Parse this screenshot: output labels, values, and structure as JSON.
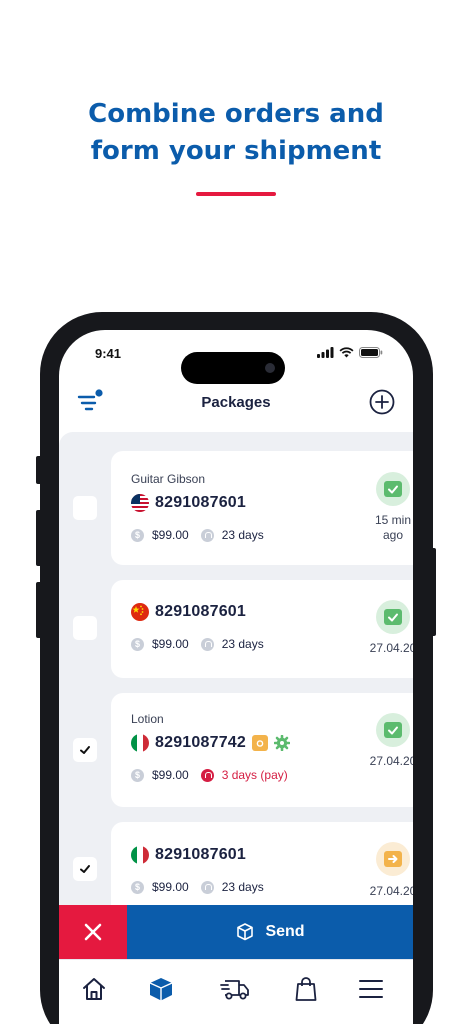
{
  "headline": {
    "line1": "Combine orders and",
    "line2": "form your shipment"
  },
  "status_bar": {
    "time": "9:41"
  },
  "header": {
    "title": "Packages"
  },
  "packages": [
    {
      "name": "Guitar Gibson",
      "flag": "us-flag-icon",
      "tracking": "8291087601",
      "price": "$99.00",
      "duration": "23 days",
      "status_text": "15 min\nago",
      "status_icon": "package-check-icon",
      "checked": false
    },
    {
      "name": "",
      "flag": "china-flag-icon",
      "tracking": "8291087601",
      "price": "$99.00",
      "duration": "23 days",
      "status_text": "27.04.20",
      "status_icon": "package-check-icon",
      "checked": false
    },
    {
      "name": "Lotion",
      "flag": "italy-flag-icon",
      "tracking": "8291087742",
      "price": "$99.00",
      "duration": "3 days (pay)",
      "status_text": "27.04.20",
      "status_icon": "package-check-icon",
      "checked": true,
      "extras": [
        "camera-icon",
        "gear-icon"
      ]
    },
    {
      "name": "",
      "flag": "italy-flag-icon",
      "tracking": "8291087601",
      "price": "$99.00",
      "duration": "23 days",
      "status_text": "27.04.20",
      "status_icon": "package-forward-icon",
      "checked": true
    }
  ],
  "action_bar": {
    "send_label": "Send"
  },
  "tabbar": {
    "items": [
      "home-icon",
      "box-icon",
      "truck-icon",
      "shopping-bag-icon",
      "menu-icon"
    ]
  },
  "colors": {
    "brand_blue": "#0b5cab",
    "accent_red": "#e5193f",
    "success_green": "#5cbb6e",
    "pending_amber": "#f3b34b",
    "list_bg": "#eef0f4"
  }
}
